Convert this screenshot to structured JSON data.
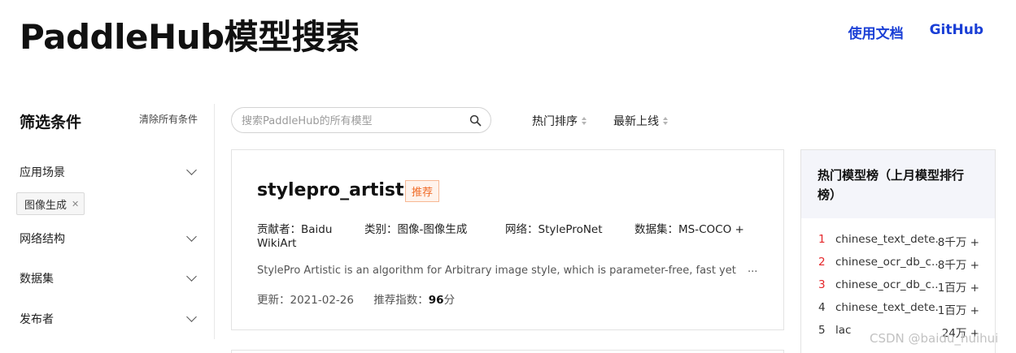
{
  "header": {
    "title": "PaddleHub模型搜索",
    "nav": [
      "使用文档",
      "GitHub"
    ]
  },
  "sidebar": {
    "title": "筛选条件",
    "clear_all": "清除所有条件",
    "filters": [
      "应用场景",
      "网络结构",
      "数据集",
      "发布者"
    ],
    "active_tag": "图像生成",
    "tag_close_icon": "close-icon"
  },
  "search": {
    "placeholder": "搜索PaddleHub的所有模型",
    "value": ""
  },
  "sort": {
    "options": [
      "热门排序",
      "最新上线"
    ]
  },
  "model_card": {
    "name": "stylepro_artistic",
    "badge": "推荐",
    "contributor": "贡献者：Baidu",
    "category": "类别：图像-图像生成",
    "network": "网络：StyleProNet",
    "dataset_line1": "数据集：MS-COCO +",
    "dataset_line2": "WikiArt",
    "description": "StylePro Artistic is an algorithm for Arbitrary image style, which is parameter-free, fast yet",
    "more": "...",
    "updated": "更新：2021-02-26",
    "score_label": "推荐指数：",
    "score_value": "96",
    "score_unit": "分"
  },
  "ranking": {
    "title": "热门模型榜（上月模型排行榜）",
    "items": [
      {
        "rank": "1",
        "name": "chinese_text_dete...",
        "count": "8千万 +"
      },
      {
        "rank": "2",
        "name": "chinese_ocr_db_c...",
        "count": "8千万 +"
      },
      {
        "rank": "3",
        "name": "chinese_ocr_db_c...",
        "count": "1百万 +"
      },
      {
        "rank": "4",
        "name": "chinese_text_dete...",
        "count": "1百万 +"
      },
      {
        "rank": "5",
        "name": "lac",
        "count": "24万 +"
      }
    ]
  },
  "colors": {
    "link": "#1a3fd6",
    "badge": "#f06b27",
    "top_rank": "#e5262a",
    "rank_header_bg": "#f4f5fa"
  },
  "watermark": "CSDN @baidu_huihui"
}
